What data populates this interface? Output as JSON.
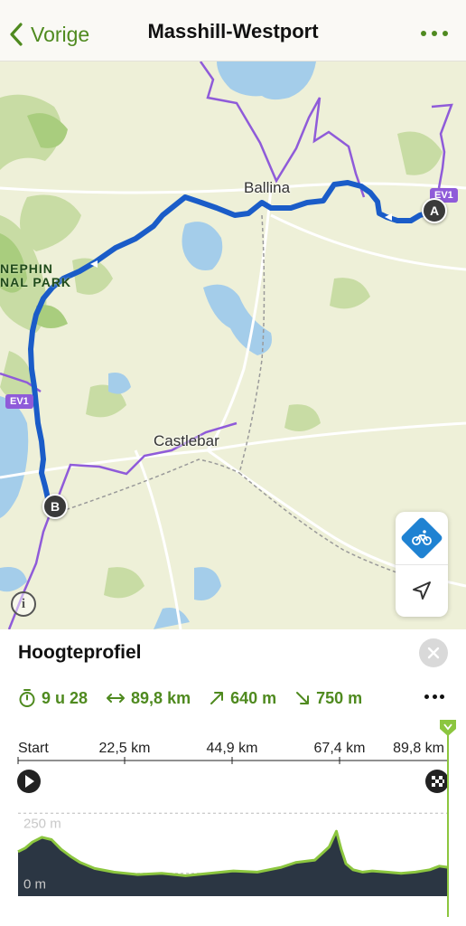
{
  "nav": {
    "back_label": "Vorige",
    "title": "Masshill-Westport"
  },
  "map": {
    "places": [
      "Ballina",
      "Castlebar"
    ],
    "park_label_line1": "NEPHIN",
    "park_label_line2": "NAL PARK",
    "route_badges": [
      "EV1",
      "EV1"
    ],
    "start_marker": "A",
    "end_marker": "B",
    "info_label": "i",
    "route_color": "#1a5cc8",
    "border_color": "#8f5bd9"
  },
  "panel": {
    "title": "Hoogteprofiel",
    "stats": {
      "duration": "9 u 28",
      "distance": "89,8 km",
      "ascent": "640 m",
      "descent": "750 m"
    },
    "accent_color": "#4f8a1f"
  },
  "chart_data": {
    "type": "area",
    "title": "Hoogteprofiel",
    "x_tick_labels": [
      "Start",
      "22,5 km",
      "44,9 km",
      "67,4 km",
      "89,8 km"
    ],
    "xlim": [
      0,
      89.8
    ],
    "y_tick_labels": [
      "250 m",
      "0 m"
    ],
    "ylim": [
      -95,
      300
    ],
    "x": [
      0,
      1.5,
      3,
      5,
      7,
      9,
      11,
      13,
      16,
      20,
      25,
      30,
      35,
      40,
      45,
      50,
      55,
      58,
      62,
      65,
      66.5,
      67.5,
      68.5,
      70,
      72,
      74,
      77,
      80,
      83,
      86,
      88,
      89.8
    ],
    "series": [
      {
        "values": [
          90,
          105,
          130,
          150,
          140,
          100,
          70,
          45,
          20,
          5,
          -5,
          0,
          -10,
          0,
          10,
          5,
          25,
          45,
          55,
          110,
          175,
          100,
          40,
          15,
          5,
          10,
          5,
          0,
          5,
          15,
          30,
          25
        ]
      }
    ]
  }
}
